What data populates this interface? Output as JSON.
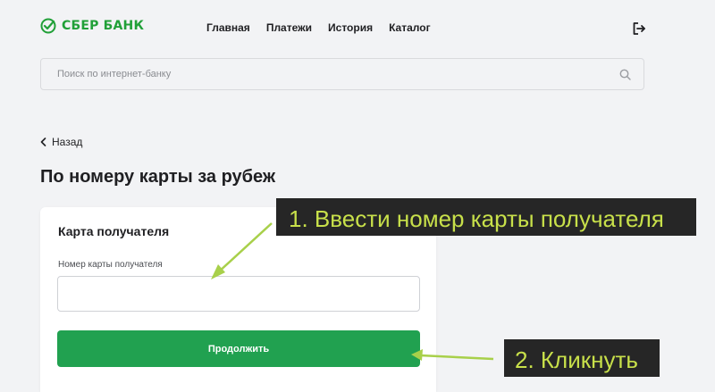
{
  "header": {
    "logo_text": "СБЕР БАНК",
    "nav": [
      {
        "label": "Главная"
      },
      {
        "label": "Платежи"
      },
      {
        "label": "История"
      },
      {
        "label": "Каталог"
      }
    ],
    "logout_icon": "logout-icon"
  },
  "search": {
    "placeholder": "Поиск по интернет-банку",
    "value": "",
    "icon": "search-icon"
  },
  "back": {
    "label": "Назад",
    "icon": "chevron-left-icon"
  },
  "page": {
    "title": "По номеру карты за рубеж"
  },
  "card": {
    "title": "Карта получателя",
    "field_label": "Номер карты получателя",
    "field_value": "",
    "button_label": "Продолжить"
  },
  "annotations": {
    "step1": "1. Ввести номер карты получателя",
    "step2": "2. Кликнуть"
  },
  "colors": {
    "brand_green": "#21a038",
    "button_green": "#21a150",
    "annotation_text": "#c8e04a",
    "annotation_bg": "#262626",
    "arrow": "#a8d04a"
  }
}
